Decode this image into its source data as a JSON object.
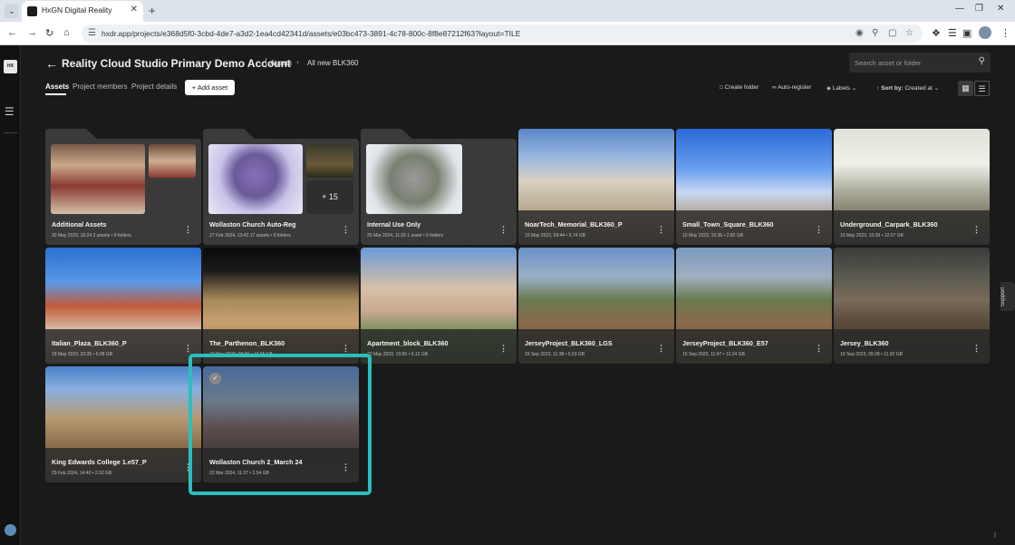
{
  "browser": {
    "tab_title": "HxGN Digital Reality",
    "url": "hxdr.app/projects/e368d5f0-3cbd-4de7-a3d2-1ea4cd42341d/assets/e03bc473-3891-4c78-800c-8f8e87212f63?layout=TILE"
  },
  "header": {
    "account_title": "Reality Cloud Studio Primary Demo Account",
    "separator": "|",
    "breadcrumb_assets": "Assets",
    "breadcrumb_current": "All new BLK360",
    "search_placeholder": "Search asset or folder"
  },
  "nav_tabs": [
    "Assets",
    "Project members",
    "Project details"
  ],
  "add_asset_label": "Add asset",
  "toolbar": {
    "create_folder": "Create folder",
    "auto_register": "Auto-register",
    "labels": "Labels",
    "sort_by_label": "Sort by:",
    "sort_by_value": "Created at"
  },
  "support_label": "Support",
  "plus_more_label": "+ 15",
  "folders": [
    {
      "title": "Additional Assets",
      "meta": "30 May 2023, 16:24 2 assets • 0 folders"
    },
    {
      "title": "Wollaston Church Auto-Reg",
      "meta": "27 Feb 2024, 13:42 17 assets • 0 folders"
    },
    {
      "title": "Internal Use Only",
      "meta": "25 Mar 2024, 11:26 1 asset • 0 folders"
    }
  ],
  "assets": [
    {
      "title": "NoarTech_Memorial_BLK360_P",
      "meta": "10 May 2023, 09:44 • 5.74 GB"
    },
    {
      "title": "Small_Town_Square_BLK360",
      "meta": "10 May 2023, 10:36 • 2.82 GB"
    },
    {
      "title": "Underground_Carpark_BLK360",
      "meta": "10 May 2023, 10:39 • 12.07 GB"
    },
    {
      "title": "Italian_Plaza_BLK360_P",
      "meta": "18 May 2023, 20:35 • 5.08 GB"
    },
    {
      "title": "The_Parthenon_BLK360",
      "meta": "19 May 2023, 09:00 • 10.05 GB"
    },
    {
      "title": "Apartment_block_BLK360",
      "meta": "23 May 2023, 10:56 • 6.12 GB"
    },
    {
      "title": "JerseyProject_BLK360_LGS",
      "meta": "15 Sep 2023, 11:38 • 5.63 GB"
    },
    {
      "title": "JerseyProject_BLK360_E57",
      "meta": "15 Sep 2023, 11:47 • 12.24 GB"
    },
    {
      "title": "Jersey_BLK360",
      "meta": "19 Sep 2023, 09:28 • 11.92 GB"
    },
    {
      "title": "King Edwards College 1.e57_P",
      "meta": "29 Feb 2024, 14:40 • 2.52 GB"
    },
    {
      "title": "Wollaston Church 2_March 24",
      "meta": "22 Mar 2024, 11:37 • 3.54 GB"
    }
  ],
  "colors": {
    "highlight": "#2abfbf",
    "background": "#1a1a1a",
    "card": "#3a3a3a"
  }
}
